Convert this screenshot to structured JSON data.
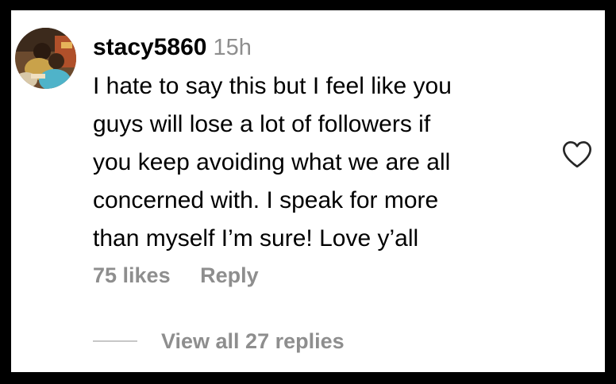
{
  "comment": {
    "username": "stacy5860",
    "timestamp": "15h",
    "avatar_icon": "profile-photo",
    "text_lines": [
      "I hate to say this but I feel like you",
      "guys will lose a lot of followers if",
      "you keep avoiding what we are all",
      "concerned with. I speak for more",
      "than myself I’m sure! Love y’all"
    ],
    "like_icon": "heart-outline-icon",
    "likes_label": "75 likes",
    "reply_label": "Reply",
    "view_replies_label": "View all 27 replies"
  },
  "colors": {
    "border": "#000000",
    "background": "#ffffff",
    "text_primary": "#000000",
    "text_secondary": "#8e8e8e"
  }
}
